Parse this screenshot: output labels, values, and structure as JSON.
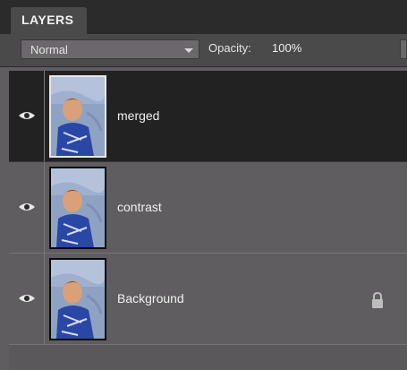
{
  "panel": {
    "tab_label": "LAYERS"
  },
  "options": {
    "blend_mode": "Normal",
    "opacity_label": "Opacity:",
    "opacity_value": "100%"
  },
  "layers": [
    {
      "name": "merged",
      "selected": true,
      "visible": true,
      "locked": false
    },
    {
      "name": "contrast",
      "selected": false,
      "visible": true,
      "locked": false
    },
    {
      "name": "Background",
      "selected": false,
      "visible": true,
      "locked": true
    }
  ],
  "icons": {
    "visibility": "eye-icon",
    "lock": "lock-icon",
    "dropdown": "chevron-down-icon"
  }
}
